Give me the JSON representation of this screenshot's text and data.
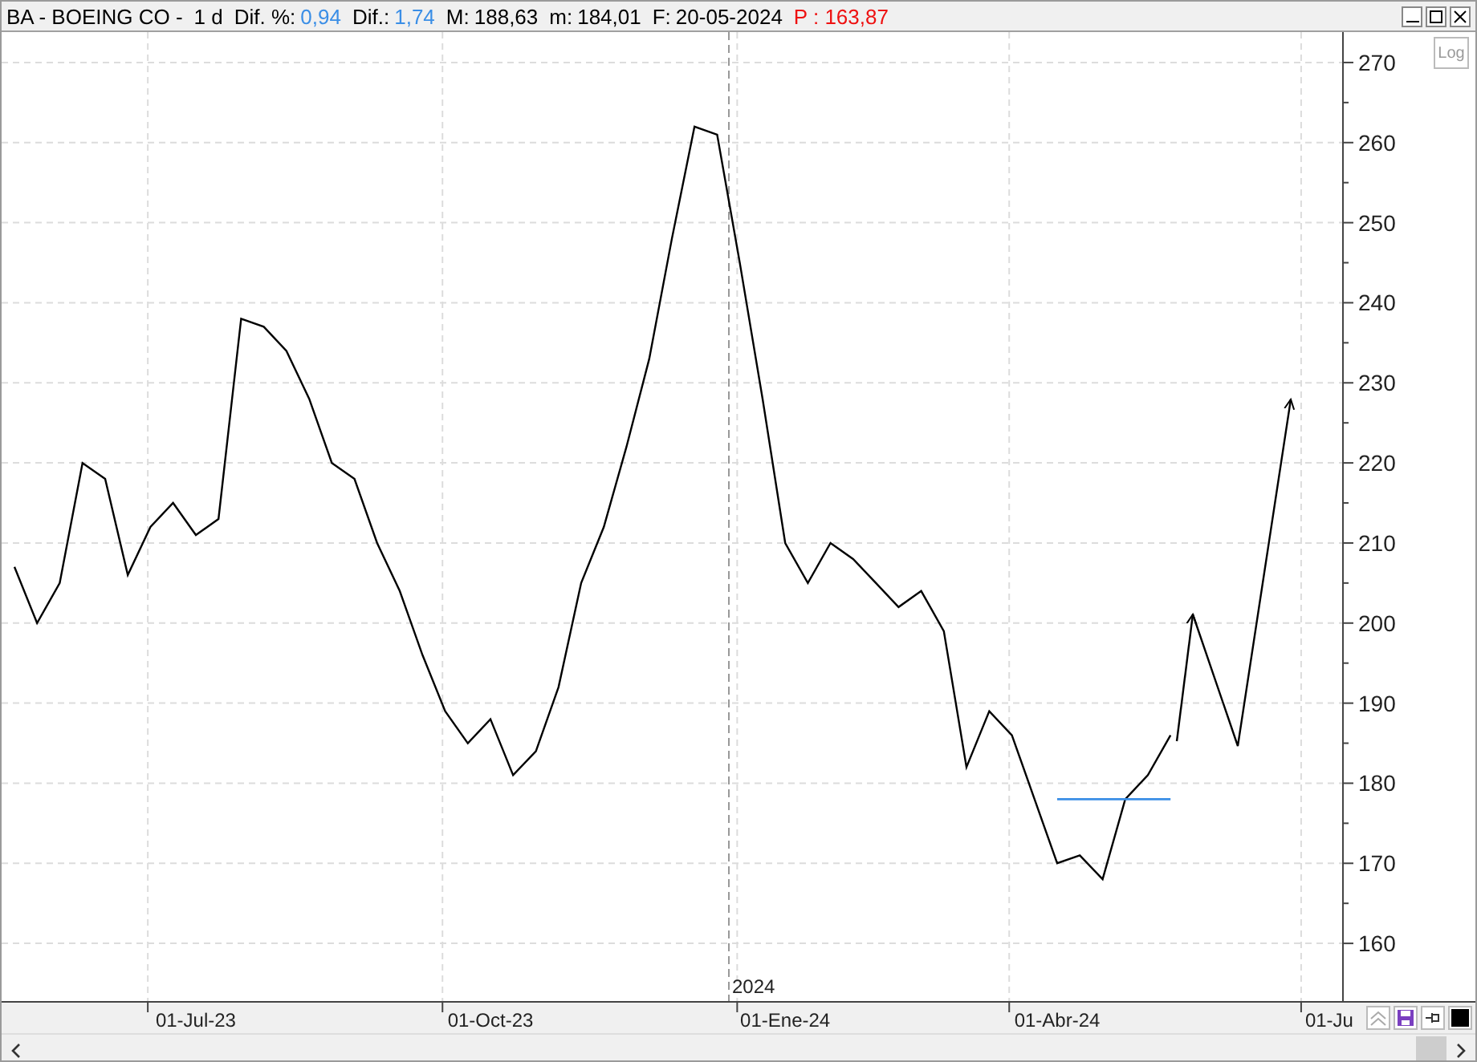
{
  "header": {
    "items": [
      {
        "kind": "plain",
        "text": "BA - BOEING CO -",
        "color": "#000000"
      },
      {
        "kind": "plain",
        "text": "1 d",
        "color": "#000000"
      },
      {
        "kind": "pair",
        "label": "Dif. %:",
        "value": "0,94",
        "color": "#3a8ee6"
      },
      {
        "kind": "pair",
        "label": "Dif.:",
        "value": "1,74",
        "color": "#3a8ee6"
      },
      {
        "kind": "pair",
        "label": "M:",
        "value": "188,63",
        "color": "#000000"
      },
      {
        "kind": "pair",
        "label": "m:",
        "value": "184,01",
        "color": "#000000"
      },
      {
        "kind": "pair",
        "label": "F:",
        "value": "20-05-2024",
        "color": "#000000"
      },
      {
        "kind": "plain",
        "text": "P : 163,87",
        "color": "#ee1111"
      }
    ]
  },
  "log_button": {
    "label": "Log",
    "on": false
  },
  "year_marker": {
    "label": "2024"
  },
  "chart_data": {
    "type": "line",
    "grid": true,
    "categories": [
      null,
      null,
      null,
      null,
      null,
      null,
      null,
      null,
      "01-Jul-23",
      null,
      null,
      null,
      null,
      null,
      null,
      null,
      null,
      null,
      null,
      null,
      null,
      "01-Oct-23",
      null,
      null,
      null,
      null,
      null,
      null,
      null,
      null,
      null,
      null,
      null,
      null,
      "01-Ene-24",
      null,
      null,
      null,
      null,
      null,
      null,
      null,
      null,
      null,
      null,
      null,
      "01-Abr-24",
      null,
      null,
      null,
      null,
      null,
      null,
      null,
      null,
      null,
      null,
      null,
      "01-Ju"
    ],
    "series": [
      {
        "color": "#000000",
        "values": [
          207,
          200,
          205,
          220,
          218,
          206,
          212,
          215,
          211,
          213,
          238,
          237,
          234,
          228,
          220,
          218,
          210,
          204,
          196,
          189,
          185,
          188,
          181,
          184,
          192,
          205,
          212,
          222,
          233,
          248,
          262,
          261,
          245,
          228,
          210,
          205,
          210,
          208,
          205,
          202,
          204,
          199,
          182,
          189,
          186,
          178,
          170,
          171,
          168,
          178,
          181,
          186,
          null,
          null,
          null,
          null,
          null,
          null,
          null
        ]
      },
      {
        "color": "#3a8ee6",
        "values": [
          null,
          null,
          null,
          null,
          null,
          null,
          null,
          null,
          null,
          null,
          null,
          null,
          null,
          null,
          null,
          null,
          null,
          null,
          null,
          null,
          null,
          null,
          null,
          null,
          null,
          null,
          null,
          null,
          null,
          null,
          null,
          null,
          null,
          null,
          null,
          null,
          null,
          null,
          null,
          null,
          null,
          null,
          null,
          null,
          null,
          null,
          178,
          178,
          178,
          178,
          178,
          178,
          null,
          null,
          null,
          null,
          null,
          null,
          null
        ]
      }
    ],
    "ylim": [
      152.8,
      273.8
    ],
    "yticks": [
      160,
      170,
      180,
      190,
      200,
      210,
      220,
      230,
      240,
      250,
      260,
      270
    ]
  }
}
